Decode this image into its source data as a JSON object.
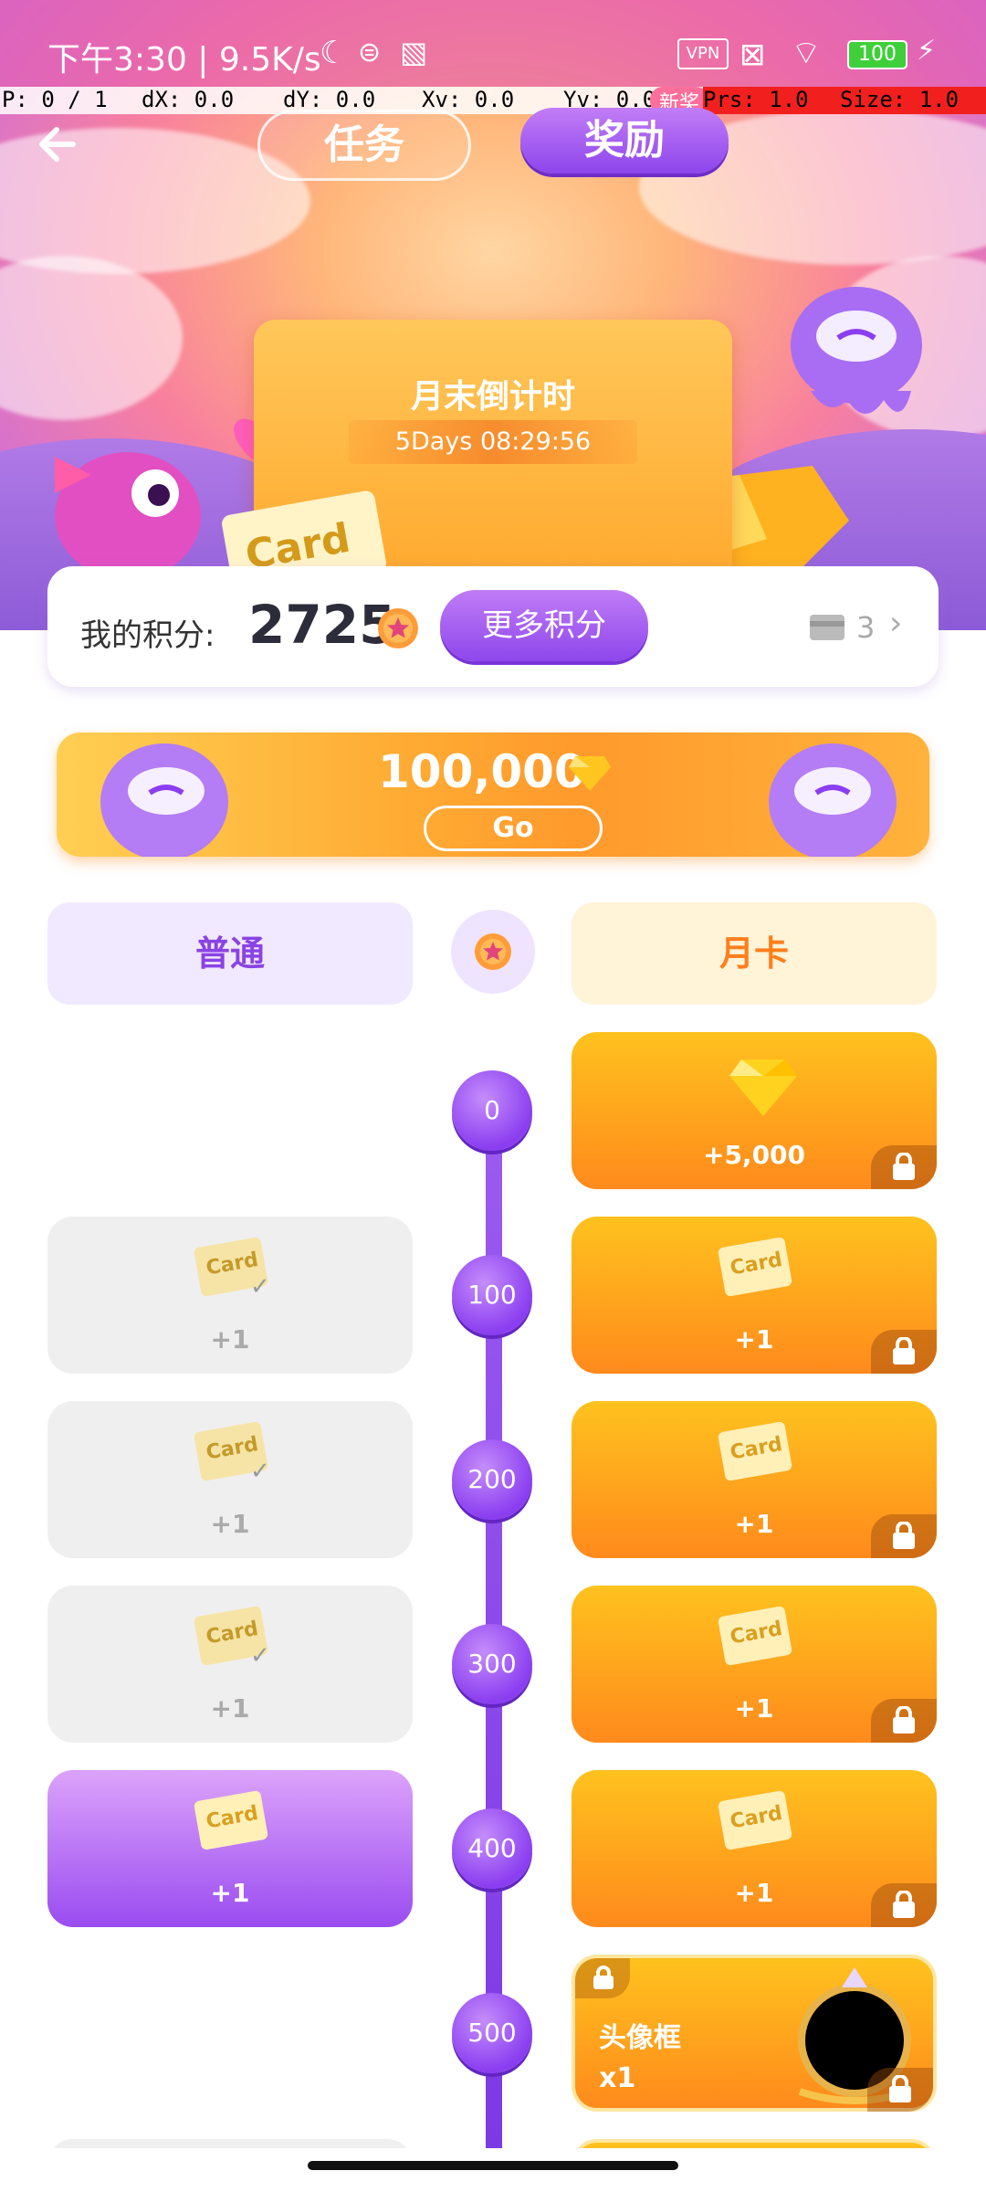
{
  "status_bar": {
    "time_speed": "下午3:30 | 9.5K/s",
    "vpn": "VPN",
    "battery": "100"
  },
  "debug_bar": {
    "p": "P: 0 / 1",
    "dx": "dX: 0.0",
    "dy": "dY: 0.0",
    "xv": "Xv: 0.0",
    "yv": "Yv: 0.0",
    "prs": "Prs: 1.0",
    "size": "Size: 1.0",
    "new_badge": "新奖"
  },
  "header": {
    "tab_task": "任务",
    "tab_reward": "奖励"
  },
  "countdown": {
    "title": "月末倒计时",
    "timer": "5Days 08:29:56",
    "card_word": "Card"
  },
  "points": {
    "label": "我的积分:",
    "value": "2725",
    "more_button": "更多积分",
    "card_count": "3"
  },
  "banner": {
    "amount": "100,000",
    "go": "Go"
  },
  "columns": {
    "normal": "普通",
    "month_card": "月卡"
  },
  "tiers": [
    {
      "threshold": "0",
      "normal": null,
      "month": {
        "amount": "+5,000",
        "type": "diamond"
      }
    },
    {
      "threshold": "100",
      "normal": {
        "amount": "+1",
        "state": "claimed"
      },
      "month": {
        "amount": "+1",
        "type": "card"
      }
    },
    {
      "threshold": "200",
      "normal": {
        "amount": "+1",
        "state": "claimed"
      },
      "month": {
        "amount": "+1",
        "type": "card"
      }
    },
    {
      "threshold": "300",
      "normal": {
        "amount": "+1",
        "state": "claimed"
      },
      "month": {
        "amount": "+1",
        "type": "card"
      }
    },
    {
      "threshold": "400",
      "normal": {
        "amount": "+1",
        "state": "available"
      },
      "month": {
        "amount": "+1",
        "type": "card"
      }
    },
    {
      "threshold": "500",
      "normal": null,
      "month": {
        "label": "头像框",
        "amount": "x1",
        "type": "frame"
      }
    }
  ],
  "card_icon_text": "Card",
  "colors": {
    "accent_purple": "#8d45ec",
    "accent_orange": "#ff8a1c"
  }
}
